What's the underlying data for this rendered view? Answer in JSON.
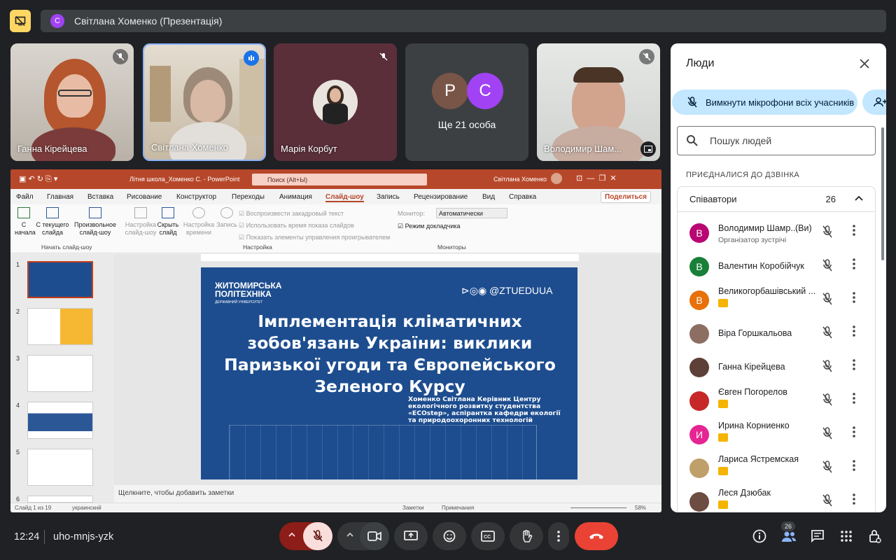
{
  "presenter_bar": {
    "avatar_letter": "С",
    "label": "Світлана Хоменко (Презентація)"
  },
  "tiles": [
    {
      "name": "Ганна Кірейцева"
    },
    {
      "name": "Світлана Хоменко"
    },
    {
      "name": "Марія Корбут"
    },
    {
      "name": "Ще 21 особа",
      "letters": [
        "Р",
        "С"
      ]
    },
    {
      "name": "Володимир Шам..."
    }
  ],
  "people_panel": {
    "title": "Люди",
    "mute_all_label": "Вимкнути мікрофони всіх учасників",
    "search_placeholder": "Пошук людей",
    "section_label": "ПРИЄДНАЛИСЯ ДО ДЗВІНКА",
    "cohosts_label": "Співавтори",
    "cohosts_count": "26",
    "people": [
      {
        "letter": "В",
        "color": "#b80672",
        "name": "Володимир Шамр...",
        "you": "(Ви)",
        "sub": "Організатор зустрічі"
      },
      {
        "letter": "В",
        "color": "#188038",
        "name": "Валентин Коробійчук"
      },
      {
        "letter": "В",
        "color": "#e8710a",
        "name": "Великогорбашівський ..."
      },
      {
        "letter": "",
        "color": "#8d6e63",
        "name": "Віра Горшкальова"
      },
      {
        "letter": "",
        "color": "#5d4037",
        "name": "Ганна Кірейцева"
      },
      {
        "letter": "",
        "color": "#c62828",
        "name": "Євген Погорелов"
      },
      {
        "letter": "И",
        "color": "#e52592",
        "name": "Ирина Корниенко"
      },
      {
        "letter": "",
        "color": "#bf9f6a",
        "name": "Лариса Ястремская"
      },
      {
        "letter": "",
        "color": "#6d4c41",
        "name": "Леся Дзюбак"
      }
    ]
  },
  "powerpoint": {
    "doc_title": "Літня школа_Хоменко С.  -  PowerPoint",
    "search_placeholder": "Поиск (Alt+Ы)",
    "user": "Світлана Хоменко",
    "menu": [
      "Файл",
      "Главная",
      "Вставка",
      "Рисование",
      "Конструктор",
      "Переходы",
      "Анимация",
      "Слайд-шоу",
      "Запись",
      "Рецензирование",
      "Вид",
      "Справка"
    ],
    "share": "Поделиться",
    "ribbon": {
      "from_start": "С начала",
      "from_current": "С текущего слайда",
      "online": "Произвольное слайд-шоу",
      "group1": "Начать слайд-шоу",
      "setup": "Настройка слайд-шоу",
      "hide": "Скрыть слайд",
      "timing": "Настройка времени",
      "record": "Запись",
      "cb1": "Воспроизвести закадровый текст",
      "cb2": "Использовать время показа слайдов",
      "cb3": "Показать элементы управления проигрывателем",
      "group2": "Настройка",
      "monitor_label": "Монитор:",
      "monitor_value": "Автоматически",
      "presenter_view": "Режим докладчика",
      "group3": "Мониторы"
    },
    "slide_numbers": [
      "1",
      "2",
      "3",
      "4",
      "5",
      "6"
    ],
    "slide": {
      "logo_line1": "ЖИТОМИРСЬКА",
      "logo_line2": "ПОЛІТЕХНІКА",
      "logo_line3": "ДЕРЖАВНИЙ УНІВЕРСИТЕТ",
      "social": "@ZTUEDUUA",
      "title": "Імплементація кліматичних зобов'язань України: виклики Паризької угоди та Європейського Зеленого Курсу",
      "author": "Хоменко Світлана Керівник Центру екологічного розвитку студентства «ECOstep», аспірантка кафедри екології та природоохоронних технологій"
    },
    "notes_placeholder": "Щелкните, чтобы добавить заметки",
    "status_slide": "Слайд 1 из 19",
    "status_lang": "украинский",
    "status_notes": "Заметки",
    "status_comments": "Примечания",
    "zoom": "58%"
  },
  "bottom": {
    "time": "12:24",
    "meeting_code": "uho-mnjs-yzk",
    "people_count": "26"
  },
  "colors": {
    "end_call": "#ea4335",
    "mic_off": "#f9dedc",
    "accent": "#c2e7ff"
  }
}
